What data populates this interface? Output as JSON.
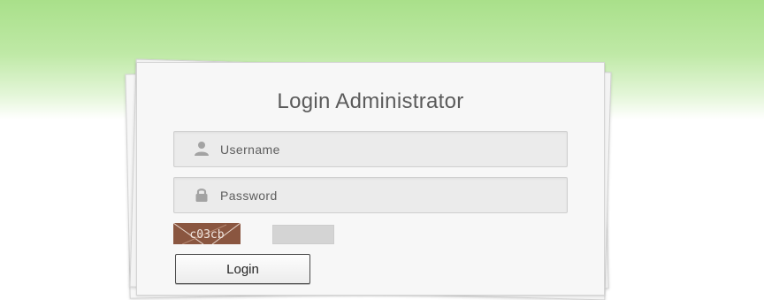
{
  "login_form": {
    "title": "Login Administrator",
    "username_placeholder": "Username",
    "password_placeholder": "Password",
    "captcha_code": "c03cb",
    "login_label": "Login"
  },
  "colors": {
    "header_gradient": "#a9e08a",
    "captcha_background": "#8a5640",
    "card_background": "#f7f7f7"
  },
  "icons": {
    "username": "user-icon",
    "password": "lock-icon"
  }
}
